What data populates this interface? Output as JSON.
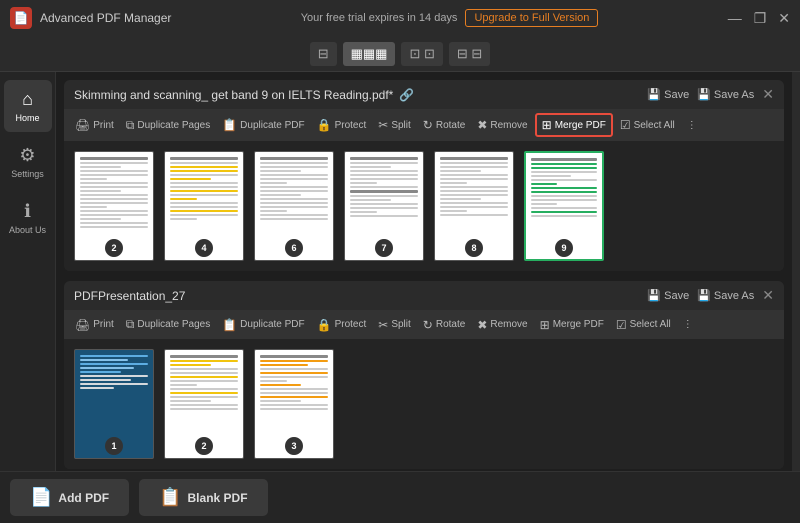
{
  "titleBar": {
    "appName": "Advanced PDF Manager",
    "appIconText": "📄",
    "trialText": "Your free trial expires in 14 days",
    "upgradeLabel": "Upgrade to Full Version",
    "controls": [
      "—",
      "❐",
      "✕"
    ]
  },
  "viewSwitcher": {
    "buttons": [
      {
        "label": "⊞",
        "id": "grid-small",
        "active": false
      },
      {
        "label": "▦",
        "id": "grid-medium",
        "active": true
      },
      {
        "label": "⊡⊡",
        "id": "grid-large",
        "active": false
      },
      {
        "label": "⊟⊟",
        "id": "list",
        "active": false
      }
    ]
  },
  "sidebar": {
    "items": [
      {
        "id": "home",
        "icon": "⌂",
        "label": "Home",
        "active": true
      },
      {
        "id": "settings",
        "icon": "⚙",
        "label": "Settings",
        "active": false
      },
      {
        "id": "about",
        "icon": "ℹ",
        "label": "About Us",
        "active": false
      }
    ]
  },
  "documents": [
    {
      "id": "doc1",
      "title": "Skimming and scanning_ get band 9 on IELTS Reading.pdf*",
      "saveLabel": "Save",
      "saveAsLabel": "Save As",
      "toolbar": {
        "buttons": [
          {
            "id": "print",
            "icon": "🖨",
            "label": "Print"
          },
          {
            "id": "duplicate-pages",
            "icon": "⧉",
            "label": "Duplicate Pages"
          },
          {
            "id": "duplicate-pdf",
            "icon": "📋",
            "label": "Duplicate PDF"
          },
          {
            "id": "protect",
            "icon": "🔒",
            "label": "Protect"
          },
          {
            "id": "split",
            "icon": "✂",
            "label": "Split"
          },
          {
            "id": "rotate",
            "icon": "↻",
            "label": "Rotate"
          },
          {
            "id": "remove",
            "icon": "✖",
            "label": "Remove"
          },
          {
            "id": "merge-pdf",
            "icon": "⊞",
            "label": "Merge PDF",
            "highlighted": true
          },
          {
            "id": "select-all",
            "icon": "☑",
            "label": "Select All"
          }
        ]
      },
      "pages": [
        {
          "number": 2,
          "type": "text"
        },
        {
          "number": 4,
          "type": "text-yellow"
        },
        {
          "number": 6,
          "type": "text"
        },
        {
          "number": 7,
          "type": "text"
        },
        {
          "number": 8,
          "type": "text"
        },
        {
          "number": 9,
          "type": "green-card"
        }
      ]
    },
    {
      "id": "doc2",
      "title": "PDFPresentation_27",
      "saveLabel": "Save",
      "saveAsLabel": "Save As",
      "toolbar": {
        "buttons": [
          {
            "id": "print",
            "icon": "🖨",
            "label": "Print"
          },
          {
            "id": "duplicate-pages",
            "icon": "⧉",
            "label": "Duplicate Pages"
          },
          {
            "id": "duplicate-pdf",
            "icon": "📋",
            "label": "Duplicate PDF"
          },
          {
            "id": "protect",
            "icon": "🔒",
            "label": "Protect"
          },
          {
            "id": "split",
            "icon": "✂",
            "label": "Split"
          },
          {
            "id": "rotate",
            "icon": "↻",
            "label": "Rotate"
          },
          {
            "id": "remove",
            "icon": "✖",
            "label": "Remove"
          },
          {
            "id": "merge-pdf",
            "icon": "⊞",
            "label": "Merge PDF",
            "highlighted": false
          },
          {
            "id": "select-all",
            "icon": "☑",
            "label": "Select All"
          }
        ]
      },
      "pages": [
        {
          "number": 1,
          "type": "ielts-cover"
        },
        {
          "number": 2,
          "type": "text-yellow"
        },
        {
          "number": 3,
          "type": "text-highlight"
        }
      ]
    }
  ],
  "bottomBar": {
    "addPdfLabel": "Add PDF",
    "blankPdfLabel": "Blank PDF"
  }
}
